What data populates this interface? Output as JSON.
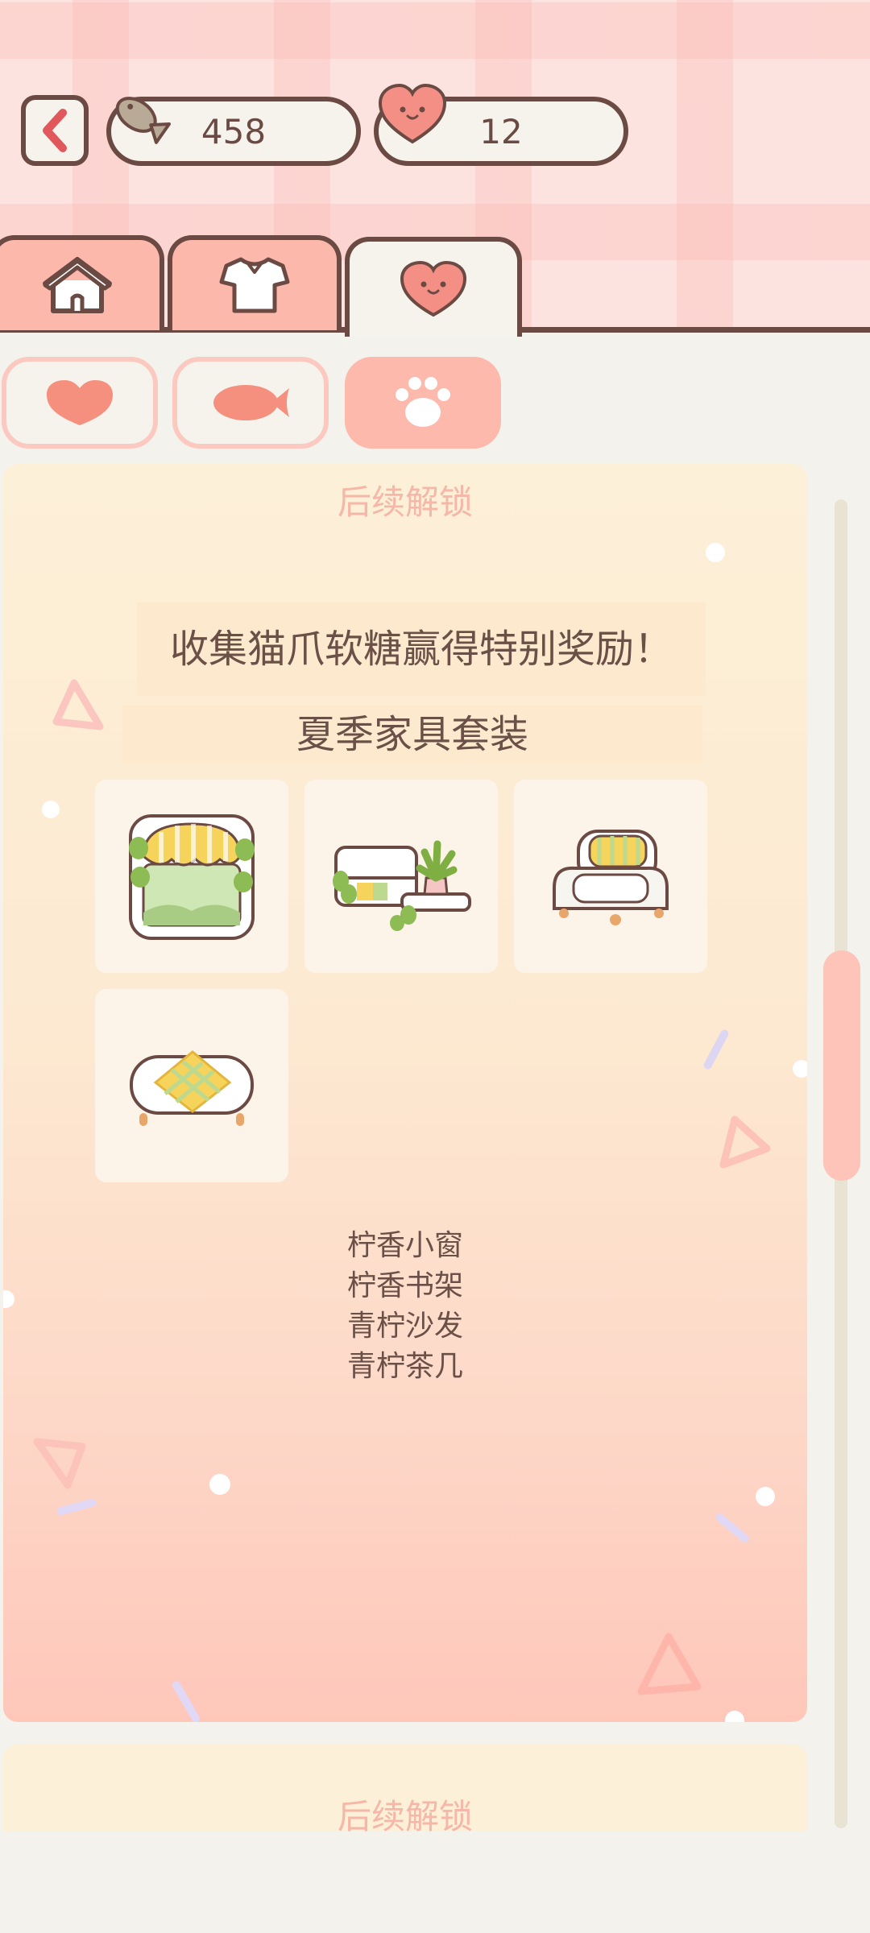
{
  "header": {
    "back_label": "back",
    "fish_count": "458",
    "heart_count": "12"
  },
  "tabs": [
    {
      "name": "home-icon"
    },
    {
      "name": "shirt-icon"
    },
    {
      "name": "heart-face-icon",
      "active": true
    }
  ],
  "subtabs": [
    {
      "name": "heart-icon"
    },
    {
      "name": "fish-icon"
    },
    {
      "name": "paw-icon",
      "active": true
    }
  ],
  "card": {
    "locked_label": "后续解锁",
    "title": "收集猫爪软糖赢得特别奖励！",
    "subtitle": "夏季家具套装",
    "items": [
      {
        "icon": "lemon-window-icon"
      },
      {
        "icon": "lemon-bookshelf-icon"
      },
      {
        "icon": "lime-sofa-icon"
      },
      {
        "icon": "lime-tea-table-icon"
      }
    ],
    "item_names": [
      "柠香小窗",
      "柠香书架",
      "青柠沙发",
      "青柠茶几"
    ]
  },
  "next_card": {
    "locked_label": "后续解锁"
  },
  "colors": {
    "outline": "#6b4a43",
    "accent_pink": "#fbb8ab",
    "cream": "#f6f3ec",
    "muted_label": "#f6b6a8"
  }
}
